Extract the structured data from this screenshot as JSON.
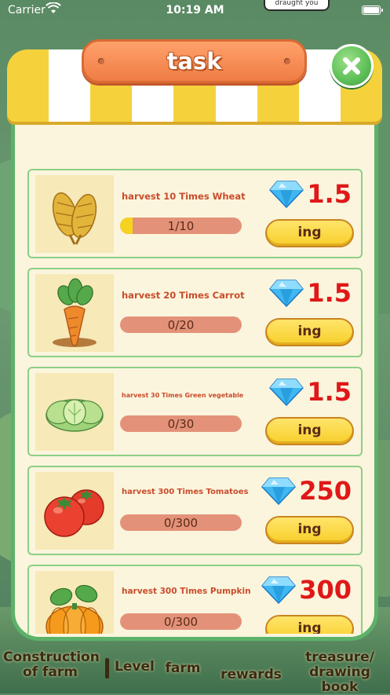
{
  "status_bar": {
    "carrier": "Carrier",
    "time": "10:19 AM",
    "bubble": "draught you"
  },
  "panel": {
    "title": "task"
  },
  "tasks": [
    {
      "label": "harvest 10 Times Wheat",
      "progress": "1/10",
      "progress_fraction": 0.1,
      "reward": "1.5",
      "button": "ing",
      "icon": "wheat-icon"
    },
    {
      "label": "harvest 20 Times Carrot",
      "progress": "0/20",
      "progress_fraction": 0,
      "reward": "1.5",
      "button": "ing",
      "icon": "carrot-icon"
    },
    {
      "label": "harvest 30 Times Green vegetable",
      "progress": "0/30",
      "progress_fraction": 0,
      "reward": "1.5",
      "button": "ing",
      "icon": "cabbage-icon"
    },
    {
      "label": "harvest 300 Times Tomatoes",
      "progress": "0/300",
      "progress_fraction": 0,
      "reward": "250",
      "button": "ing",
      "icon": "tomato-icon"
    },
    {
      "label": "harvest 300 Times Pumpkin",
      "progress": "0/300",
      "progress_fraction": 0,
      "reward": "300",
      "button": "ing",
      "icon": "pumpkin-icon"
    }
  ],
  "bottom_nav": {
    "construction": "Construction of farm",
    "level": "Level",
    "farm": "farm",
    "rewards": "rewards",
    "treasure": "treasure/ drawing book"
  },
  "colors": {
    "panel_border": "#5cb269",
    "panel_bg": "#fbf5dd",
    "title_plank": "#f07c45",
    "reward_text": "#e01818",
    "progress_track": "#e39279",
    "progress_fill": "#f5d31f",
    "button": "#f7cf2a"
  }
}
